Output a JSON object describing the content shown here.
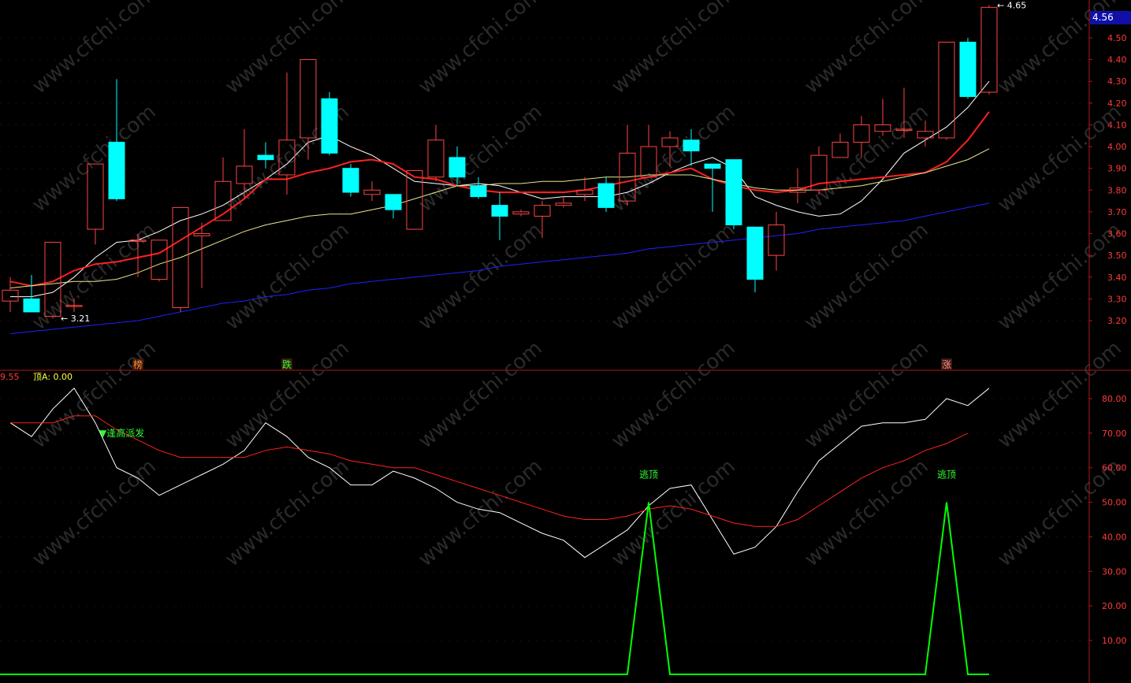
{
  "chart_data": [
    {
      "type": "candlestick",
      "title": "",
      "ylim": [
        3.1,
        4.66
      ],
      "y_ticks": [
        "4.50",
        "4.40",
        "4.30",
        "4.20",
        "4.10",
        "4.00",
        "3.90",
        "3.80",
        "3.70",
        "3.60",
        "3.50",
        "3.40",
        "3.30",
        "3.20"
      ],
      "y_tick_values": [
        4.5,
        4.4,
        4.3,
        4.2,
        4.1,
        4.0,
        3.9,
        3.8,
        3.7,
        3.6,
        3.5,
        3.4,
        3.3,
        3.2
      ],
      "last_price": "4.56",
      "candles": [
        {
          "o": 3.29,
          "c": 3.34,
          "h": 3.4,
          "l": 3.24
        },
        {
          "o": 3.3,
          "c": 3.24,
          "h": 3.41,
          "l": 3.24
        },
        {
          "o": 3.22,
          "c": 3.56,
          "h": 3.56,
          "l": 3.21
        },
        {
          "o": 3.27,
          "c": 3.27,
          "h": 3.3,
          "l": 3.24
        },
        {
          "o": 3.62,
          "c": 3.92,
          "h": 3.92,
          "l": 3.55
        },
        {
          "o": 4.02,
          "c": 3.76,
          "h": 4.31,
          "l": 3.75
        },
        {
          "o": 3.57,
          "c": 3.57,
          "h": 3.6,
          "l": 3.4
        },
        {
          "o": 3.39,
          "c": 3.57,
          "h": 3.57,
          "l": 3.38
        },
        {
          "o": 3.26,
          "c": 3.72,
          "h": 3.72,
          "l": 3.24
        },
        {
          "o": 3.59,
          "c": 3.6,
          "h": 3.65,
          "l": 3.35
        },
        {
          "o": 3.66,
          "c": 3.84,
          "h": 3.95,
          "l": 3.66
        },
        {
          "o": 3.83,
          "c": 3.91,
          "h": 4.08,
          "l": 3.76
        },
        {
          "o": 3.96,
          "c": 3.94,
          "h": 4.02,
          "l": 3.9
        },
        {
          "o": 3.87,
          "c": 4.03,
          "h": 4.34,
          "l": 3.78
        },
        {
          "o": 4.04,
          "c": 4.4,
          "h": 4.4,
          "l": 3.94
        },
        {
          "o": 4.22,
          "c": 3.97,
          "h": 4.25,
          "l": 3.96
        },
        {
          "o": 3.9,
          "c": 3.79,
          "h": 3.92,
          "l": 3.77
        },
        {
          "o": 3.78,
          "c": 3.8,
          "h": 3.84,
          "l": 3.75
        },
        {
          "o": 3.78,
          "c": 3.71,
          "h": 3.78,
          "l": 3.67
        },
        {
          "o": 3.62,
          "c": 3.89,
          "h": 3.89,
          "l": 3.62
        },
        {
          "o": 3.86,
          "c": 4.03,
          "h": 4.1,
          "l": 3.84
        },
        {
          "o": 3.95,
          "c": 3.86,
          "h": 4.0,
          "l": 3.82
        },
        {
          "o": 3.82,
          "c": 3.77,
          "h": 3.86,
          "l": 3.76
        },
        {
          "o": 3.73,
          "c": 3.68,
          "h": 3.79,
          "l": 3.57
        },
        {
          "o": 3.69,
          "c": 3.7,
          "h": 3.71,
          "l": 3.68
        },
        {
          "o": 3.68,
          "c": 3.73,
          "h": 3.75,
          "l": 3.58
        },
        {
          "o": 3.73,
          "c": 3.74,
          "h": 3.77,
          "l": 3.72
        },
        {
          "o": 3.78,
          "c": 3.8,
          "h": 3.86,
          "l": 3.75
        },
        {
          "o": 3.83,
          "c": 3.72,
          "h": 3.86,
          "l": 3.7
        },
        {
          "o": 3.75,
          "c": 3.97,
          "h": 4.1,
          "l": 3.73
        },
        {
          "o": 3.86,
          "c": 4.0,
          "h": 4.1,
          "l": 3.86
        },
        {
          "o": 4.0,
          "c": 4.04,
          "h": 4.07,
          "l": 3.91
        },
        {
          "o": 4.03,
          "c": 3.98,
          "h": 4.08,
          "l": 3.91
        },
        {
          "o": 3.92,
          "c": 3.9,
          "h": 3.92,
          "l": 3.7
        },
        {
          "o": 3.94,
          "c": 3.64,
          "h": 3.94,
          "l": 3.62
        },
        {
          "o": 3.63,
          "c": 3.39,
          "h": 3.63,
          "l": 3.33
        },
        {
          "o": 3.5,
          "c": 3.64,
          "h": 3.7,
          "l": 3.43
        },
        {
          "o": 3.79,
          "c": 3.81,
          "h": 3.9,
          "l": 3.74
        },
        {
          "o": 3.8,
          "c": 3.96,
          "h": 4.0,
          "l": 3.78
        },
        {
          "o": 3.95,
          "c": 4.02,
          "h": 4.06,
          "l": 3.95
        },
        {
          "o": 4.02,
          "c": 4.1,
          "h": 4.14,
          "l": 3.95
        },
        {
          "o": 4.07,
          "c": 4.1,
          "h": 4.22,
          "l": 4.05
        },
        {
          "o": 4.08,
          "c": 4.08,
          "h": 4.27,
          "l": 4.04
        },
        {
          "o": 4.04,
          "c": 4.07,
          "h": 4.12,
          "l": 4.0
        },
        {
          "o": 4.04,
          "c": 4.48,
          "h": 4.48,
          "l": 4.03
        },
        {
          "o": 4.48,
          "c": 4.23,
          "h": 4.5,
          "l": 4.22
        },
        {
          "o": 4.25,
          "c": 4.64,
          "h": 4.65,
          "l": 4.24
        }
      ],
      "ma_series": [
        {
          "color": "#ffffff",
          "values": [
            3.31,
            3.31,
            3.33,
            3.4,
            3.49,
            3.56,
            3.57,
            3.61,
            3.66,
            3.69,
            3.73,
            3.79,
            3.85,
            3.92,
            4.02,
            4.05,
            4.0,
            3.96,
            3.9,
            3.84,
            3.83,
            3.82,
            3.83,
            3.82,
            3.79,
            3.76,
            3.77,
            3.77,
            3.77,
            3.79,
            3.83,
            3.88,
            3.92,
            3.95,
            3.9,
            3.77,
            3.73,
            3.7,
            3.68,
            3.69,
            3.75,
            3.85,
            3.97,
            4.03,
            4.09,
            4.18,
            4.3
          ]
        },
        {
          "color": "#ff2020",
          "values": [
            3.38,
            3.36,
            3.38,
            3.43,
            3.46,
            3.47,
            3.49,
            3.51,
            3.57,
            3.63,
            3.69,
            3.76,
            3.85,
            3.85,
            3.88,
            3.9,
            3.93,
            3.94,
            3.92,
            3.86,
            3.85,
            3.82,
            3.8,
            3.79,
            3.79,
            3.79,
            3.79,
            3.8,
            3.82,
            3.84,
            3.86,
            3.88,
            3.9,
            3.85,
            3.82,
            3.8,
            3.79,
            3.8,
            3.83,
            3.84,
            3.85,
            3.86,
            3.87,
            3.88,
            3.93,
            4.03,
            4.16
          ]
        },
        {
          "color": "#e8e890",
          "values": [
            3.35,
            3.36,
            3.37,
            3.38,
            3.38,
            3.39,
            3.42,
            3.46,
            3.49,
            3.53,
            3.57,
            3.61,
            3.64,
            3.66,
            3.68,
            3.69,
            3.69,
            3.71,
            3.73,
            3.76,
            3.79,
            3.82,
            3.82,
            3.83,
            3.83,
            3.84,
            3.84,
            3.85,
            3.86,
            3.86,
            3.87,
            3.87,
            3.87,
            3.85,
            3.83,
            3.81,
            3.8,
            3.8,
            3.8,
            3.81,
            3.82,
            3.84,
            3.86,
            3.88,
            3.91,
            3.94,
            3.99
          ]
        },
        {
          "color": "#2020ff",
          "values": [
            3.14,
            3.15,
            3.16,
            3.17,
            3.18,
            3.19,
            3.2,
            3.22,
            3.24,
            3.26,
            3.28,
            3.29,
            3.31,
            3.32,
            3.34,
            3.35,
            3.37,
            3.38,
            3.39,
            3.4,
            3.41,
            3.42,
            3.43,
            3.45,
            3.46,
            3.47,
            3.48,
            3.49,
            3.5,
            3.51,
            3.53,
            3.54,
            3.55,
            3.56,
            3.57,
            3.58,
            3.59,
            3.6,
            3.62,
            3.63,
            3.64,
            3.65,
            3.66,
            3.68,
            3.7,
            3.72,
            3.74
          ]
        }
      ],
      "annotations": [
        {
          "label": "3.21",
          "index": 2,
          "value": 3.21
        },
        {
          "label": "4.65",
          "index": 46,
          "value": 4.65
        }
      ],
      "event_markers": [
        {
          "label": "榜",
          "index": 6,
          "color": "#ff9030"
        },
        {
          "label": "跌",
          "index": 13,
          "color": "#30ff30"
        },
        {
          "label": "涨",
          "index": 44,
          "color": "#ff9090"
        }
      ]
    },
    {
      "type": "line",
      "title": "",
      "ylim": [
        0,
        90
      ],
      "y_ticks": [
        "80.00",
        "70.00",
        "60.00",
        "50.00",
        "40.00",
        "30.00",
        "20.00",
        "10.00"
      ],
      "y_tick_values": [
        80,
        70,
        60,
        50,
        40,
        30,
        20,
        10
      ],
      "legend_prefix": "9.55",
      "legend_label": "顶A: 0.00",
      "series": [
        {
          "color": "#ffffff",
          "values": [
            73,
            69,
            77,
            83,
            73,
            60,
            57,
            52,
            55,
            58,
            61,
            65,
            73,
            69,
            63,
            60,
            55,
            55,
            59,
            57,
            54,
            50,
            48,
            47,
            44,
            41,
            39,
            34,
            38,
            42,
            49,
            54,
            55,
            45,
            35,
            37,
            43,
            53,
            62,
            67,
            72,
            73,
            73,
            74,
            80,
            78,
            83
          ]
        },
        {
          "color": "#ff2020",
          "values": [
            73,
            73,
            73,
            75,
            75,
            71,
            68,
            65,
            63,
            63,
            63,
            63,
            65,
            66,
            65,
            64,
            62,
            61,
            60,
            60,
            58,
            56,
            54,
            52,
            50,
            48,
            46,
            45,
            45,
            46,
            48,
            49,
            48,
            46,
            44,
            43,
            43,
            45,
            49,
            53,
            57,
            60,
            62,
            65,
            67,
            70
          ]
        },
        {
          "color": "#00ff00",
          "values": [
            0,
            0,
            0,
            0,
            0,
            0,
            0,
            0,
            0,
            0,
            0,
            0,
            0,
            0,
            0,
            0,
            0,
            0,
            0,
            0,
            0,
            0,
            0,
            0,
            0,
            0,
            0,
            0,
            0,
            0,
            50,
            0,
            0,
            0,
            0,
            0,
            0,
            0,
            0,
            0,
            0,
            0,
            0,
            0,
            50,
            0,
            0
          ]
        }
      ],
      "annotations": [
        {
          "label": "▼逢高派发",
          "index": 4,
          "value": 70,
          "color": "#30ff30"
        },
        {
          "label": "逃顶",
          "index": 30,
          "value": 58,
          "color": "#30ff30"
        },
        {
          "label": "逃顶",
          "index": 44,
          "value": 58,
          "color": "#30ff30"
        }
      ]
    }
  ],
  "colors": {
    "background": "#000000",
    "up_candle": "#ff4444",
    "down_candle": "#00ffff",
    "axis": "#b01818",
    "axis_text": "#ff3a3a",
    "grid_dots": "#800000",
    "watermark": "#2a2a2a"
  },
  "watermark_text": "www.cfchi.com"
}
